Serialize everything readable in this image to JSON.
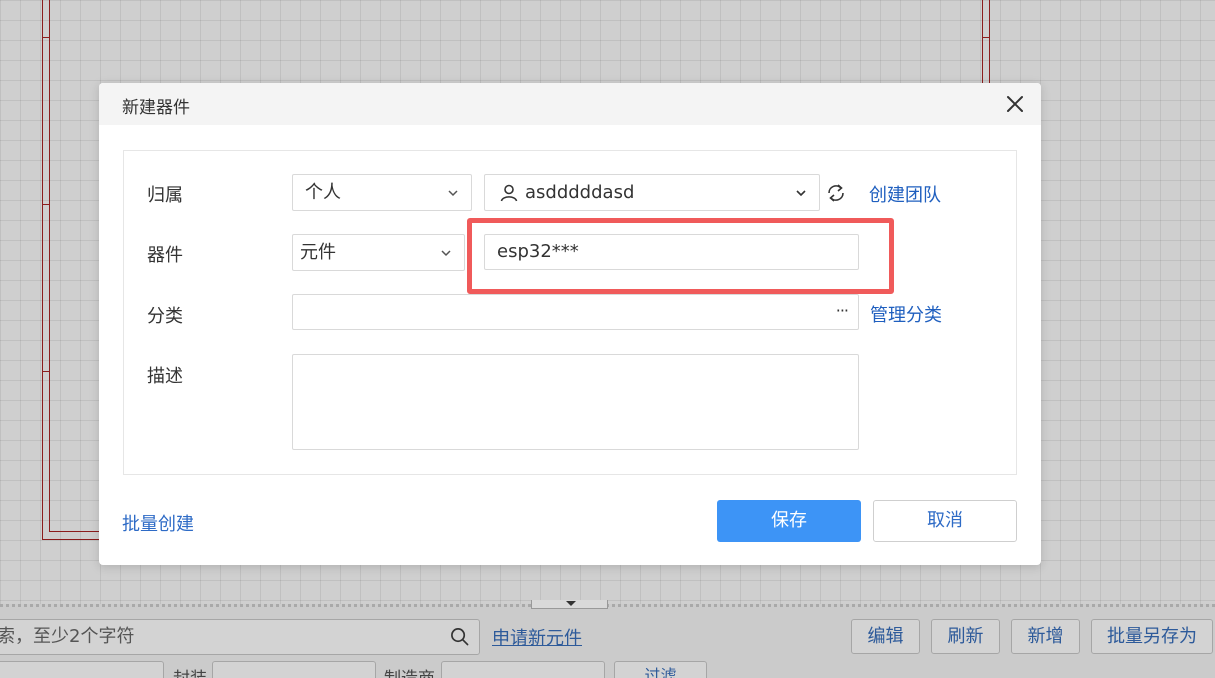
{
  "modal": {
    "title": "新建器件",
    "owner": {
      "label": "归属",
      "type_value": "个人",
      "user_value": "asdddddasd",
      "create_team_link": "创建团队"
    },
    "device": {
      "label": "器件",
      "type_value": "元件",
      "name_value": "esp32***"
    },
    "category": {
      "label": "分类",
      "value": "",
      "ellipsis": "···",
      "manage_link": "管理分类"
    },
    "description": {
      "label": "描述",
      "value": ""
    },
    "batch_create_link": "批量创建",
    "save_label": "保存",
    "cancel_label": "取消"
  },
  "bottom_panel": {
    "search_placeholder": "索，至少2个字符",
    "apply_link": "申请新元件",
    "buttons": {
      "edit": "编辑",
      "refresh": "刷新",
      "add": "新增",
      "batch_save_as": "批量另存为"
    },
    "filters": {
      "package_label": "封装",
      "manufacturer_label": "制造商",
      "filter_button": "过滤"
    }
  },
  "colors": {
    "primary": "#3d94f6",
    "link": "#1f5fbf",
    "highlight": "#f05a5a",
    "frame": "#8b1c1c"
  }
}
